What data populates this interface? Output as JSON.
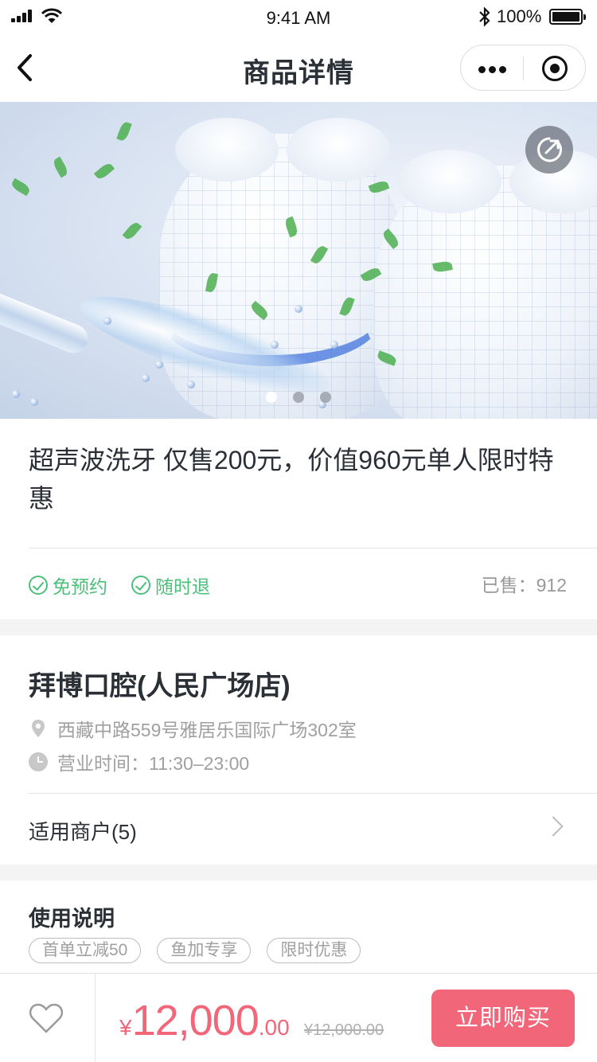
{
  "status_bar": {
    "time": "9:41 AM",
    "battery": "100%"
  },
  "nav": {
    "title": "商品详情"
  },
  "banner": {
    "slide_count": 3,
    "active_slide": 1
  },
  "product": {
    "title": "超声波洗牙 仅售200元，价值960元单人限时特惠",
    "tags": [
      "免预约",
      "随时退"
    ],
    "sold": "已售：912"
  },
  "store": {
    "name": "拜博口腔(人民广场店)",
    "address": "西藏中路559号雅居乐国际广场302室",
    "hours": "营业时间：11:30–23:00",
    "merchants": "适用商户(5)"
  },
  "usage": {
    "title": "使用说明",
    "chips": [
      "首单立减50",
      "鱼加专享",
      "限时优惠"
    ]
  },
  "bottom": {
    "currency": "¥",
    "price_int": "12,000",
    "price_dec": ".00",
    "original_price": "¥12,000.00",
    "buy_label": "立即购买"
  },
  "colors": {
    "accent": "#f2667a",
    "tag_green": "#4cbf7a"
  },
  "icons": {
    "back": "chevron-left-icon",
    "more": "more-dots-icon",
    "close": "target-circle-icon",
    "share": "share-icon",
    "tag": "check-circle-icon",
    "address": "location-pin-icon",
    "hours": "clock-icon",
    "merchants": "chevron-right-icon",
    "favorite": "heart-icon"
  }
}
